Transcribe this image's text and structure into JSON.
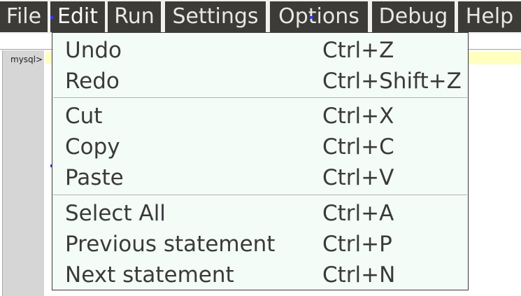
{
  "menubar": {
    "items": [
      {
        "label": "File"
      },
      {
        "label": "Edit"
      },
      {
        "label": "Run"
      },
      {
        "label": "Settings"
      },
      {
        "label": "Options"
      },
      {
        "label": "Debug"
      },
      {
        "label": "Help"
      }
    ],
    "active": "Edit"
  },
  "editor": {
    "prompt": "mysql>"
  },
  "edit_menu": {
    "groups": [
      [
        {
          "label": "Undo",
          "shortcut": "Ctrl+Z"
        },
        {
          "label": "Redo",
          "shortcut": "Ctrl+Shift+Z"
        }
      ],
      [
        {
          "label": "Cut",
          "shortcut": "Ctrl+X"
        },
        {
          "label": "Copy",
          "shortcut": "Ctrl+C"
        },
        {
          "label": "Paste",
          "shortcut": "Ctrl+V"
        }
      ],
      [
        {
          "label": "Select All",
          "shortcut": "Ctrl+A"
        },
        {
          "label": "Previous statement",
          "shortcut": "Ctrl+P"
        },
        {
          "label": "Next statement",
          "shortcut": "Ctrl+N"
        }
      ]
    ]
  },
  "colors": {
    "menubar_bg": "#3d3b37",
    "menu_text": "#e8e8e6",
    "dropdown_bg": "#f4fcf7",
    "dropdown_text": "#3a3a3a",
    "input_line": "#ffffc0",
    "gutter": "#d6d6d6",
    "selection_marker": "#3a3af0"
  }
}
